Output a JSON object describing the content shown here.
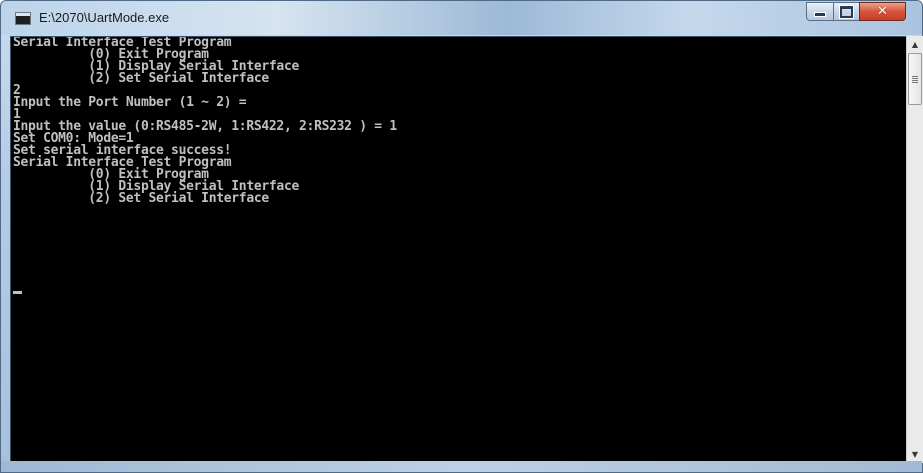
{
  "window": {
    "title": "E:\\2070\\UartMode.exe",
    "icon": "console-app-icon",
    "controls": {
      "minimize_icon": "minimize-icon",
      "maximize_icon": "maximize-icon",
      "close_icon": "close-icon",
      "close_glyph": "✕"
    }
  },
  "console": {
    "lines": [
      "Serial Interface Test Program",
      "          (0) Exit Program",
      "          (1) Display Serial Interface",
      "          (2) Set Serial Interface",
      "2",
      "Input the Port Number (1 ~ 2) =",
      "1",
      "Input the value (0:RS485-2W, 1:RS422, 2:RS232 ) = 1",
      "Set COM0: Mode=1",
      "Set serial interface success!",
      "Serial Interface Test Program",
      "          (0) Exit Program",
      "          (1) Display Serial Interface",
      "          (2) Set Serial Interface"
    ],
    "text_color": "#c0c0c0",
    "background_color": "#000000"
  },
  "scrollbar": {
    "up_arrow": "▲",
    "down_arrow": "▼"
  }
}
